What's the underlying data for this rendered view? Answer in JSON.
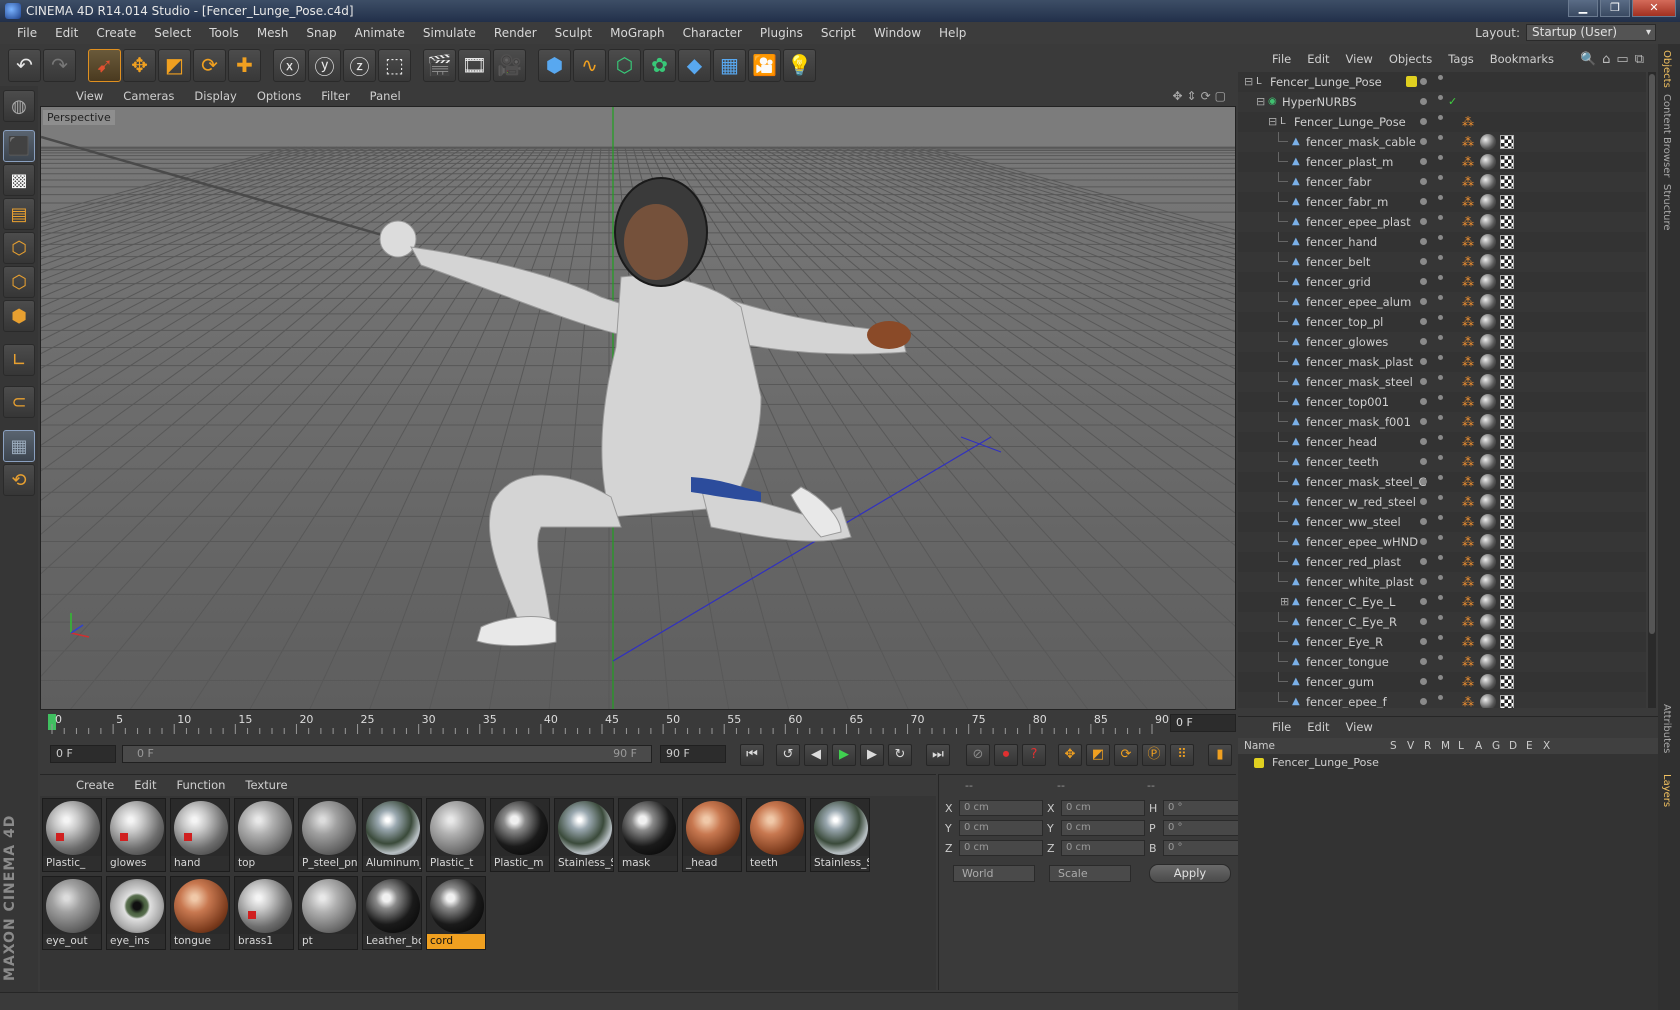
{
  "title_bar": {
    "text": "CINEMA 4D R14.014 Studio - [Fencer_Lunge_Pose.c4d]"
  },
  "menu": [
    "File",
    "Edit",
    "Create",
    "Select",
    "Tools",
    "Mesh",
    "Snap",
    "Animate",
    "Simulate",
    "Render",
    "Sculpt",
    "MoGraph",
    "Character",
    "Plugins",
    "Script",
    "Window",
    "Help"
  ],
  "layout": {
    "label": "Layout:",
    "value": "Startup (User)"
  },
  "viewport": {
    "menu": [
      "View",
      "Cameras",
      "Display",
      "Options",
      "Filter",
      "Panel"
    ],
    "label": "Perspective"
  },
  "timeline": {
    "ticks": [
      "0",
      "5",
      "10",
      "15",
      "20",
      "25",
      "30",
      "35",
      "40",
      "45",
      "50",
      "55",
      "60",
      "65",
      "70",
      "75",
      "80",
      "85",
      "90"
    ],
    "current_frame": "0 F",
    "start_field": "0 F",
    "range_start": "0 F",
    "range_end": "90 F",
    "end_field": "90 F"
  },
  "material_manager": {
    "menu": [
      "Create",
      "Edit",
      "Function",
      "Texture"
    ],
    "materials": [
      {
        "name": "Plastic_",
        "style": "red"
      },
      {
        "name": "glowes",
        "style": "red"
      },
      {
        "name": "hand",
        "style": "red"
      },
      {
        "name": "top",
        "style": "grey"
      },
      {
        "name": "P_steel_pnl",
        "style": "grid"
      },
      {
        "name": "Aluminum_",
        "style": "chrome"
      },
      {
        "name": "Plastic_t",
        "style": "grey"
      },
      {
        "name": "Plastic_m",
        "style": "black"
      },
      {
        "name": "Stainless_S",
        "style": "chrome"
      },
      {
        "name": "mask",
        "style": "black"
      },
      {
        "name": "_head",
        "style": "skin"
      },
      {
        "name": "teeth",
        "style": "skin"
      },
      {
        "name": "Stainless_S",
        "style": "chrome"
      },
      {
        "name": "eye_out",
        "style": "grid"
      },
      {
        "name": "eye_ins",
        "style": "eye"
      },
      {
        "name": "tongue",
        "style": "skin"
      },
      {
        "name": "brass1",
        "style": "red"
      },
      {
        "name": "pt",
        "style": "grey"
      },
      {
        "name": "Leather_bo",
        "style": "black"
      },
      {
        "name": "cord",
        "style": "black",
        "selected": true
      }
    ]
  },
  "coordinates": {
    "headers": [
      "--",
      "--",
      "--"
    ],
    "rows": [
      {
        "a": "X",
        "av": "0 cm",
        "b": "X",
        "bv": "0 cm",
        "c": "H",
        "cv": "0 °"
      },
      {
        "a": "Y",
        "av": "0 cm",
        "b": "Y",
        "bv": "0 cm",
        "c": "P",
        "cv": "0 °"
      },
      {
        "a": "Z",
        "av": "0 cm",
        "b": "Z",
        "bv": "0 cm",
        "c": "B",
        "cv": "0 °"
      }
    ],
    "world": "World",
    "scale": "Scale",
    "apply": "Apply"
  },
  "object_manager": {
    "menu": [
      "File",
      "Edit",
      "View",
      "Objects",
      "Tags",
      "Bookmarks"
    ],
    "objects": [
      {
        "name": "Fencer_Lunge_Pose",
        "level": 0,
        "type": "null",
        "expand": "−"
      },
      {
        "name": "HyperNURBS",
        "level": 1,
        "type": "nurbs",
        "expand": "−"
      },
      {
        "name": "Fencer_Lunge_Pose",
        "level": 2,
        "type": "null",
        "expand": "−"
      },
      {
        "name": "fencer_mask_cable",
        "level": 3
      },
      {
        "name": "fencer_plast_m",
        "level": 3
      },
      {
        "name": "fencer_fabr",
        "level": 3
      },
      {
        "name": "fencer_fabr_m",
        "level": 3
      },
      {
        "name": "fencer_epee_plast",
        "level": 3
      },
      {
        "name": "fencer_hand",
        "level": 3
      },
      {
        "name": "fencer_belt",
        "level": 3
      },
      {
        "name": "fencer_grid",
        "level": 3
      },
      {
        "name": "fencer_epee_alum",
        "level": 3
      },
      {
        "name": "fencer_top_pl",
        "level": 3
      },
      {
        "name": "fencer_glowes",
        "level": 3
      },
      {
        "name": "fencer_mask_plast",
        "level": 3
      },
      {
        "name": "fencer_mask_steel",
        "level": 3
      },
      {
        "name": "fencer_top001",
        "level": 3
      },
      {
        "name": "fencer_mask_f001",
        "level": 3
      },
      {
        "name": "fencer_head",
        "level": 3
      },
      {
        "name": "fencer_teeth",
        "level": 3
      },
      {
        "name": "fencer_mask_steel_C",
        "level": 3
      },
      {
        "name": "fencer_w_red_steel",
        "level": 3
      },
      {
        "name": "fencer_ww_steel",
        "level": 3
      },
      {
        "name": "fencer_epee_wHND",
        "level": 3
      },
      {
        "name": "fencer_red_plast",
        "level": 3
      },
      {
        "name": "fencer_white_plast",
        "level": 3
      },
      {
        "name": "fencer_C_Eye_L",
        "level": 3,
        "expand": "+"
      },
      {
        "name": "fencer_C_Eye_R",
        "level": 3
      },
      {
        "name": "fencer_Eye_R",
        "level": 3
      },
      {
        "name": "fencer_tongue",
        "level": 3
      },
      {
        "name": "fencer_gum",
        "level": 3
      },
      {
        "name": "fencer_epee_f",
        "level": 3
      }
    ]
  },
  "layer_manager": {
    "menu": [
      "File",
      "Edit",
      "View"
    ],
    "columns": [
      "Name",
      "S",
      "V",
      "R",
      "M",
      "L",
      "A",
      "G",
      "D",
      "E",
      "X"
    ],
    "layer_name": "Fencer_Lunge_Pose"
  },
  "right_tabs": [
    "Objects",
    "Content Browser",
    "Structure",
    "Attributes",
    "Layers"
  ],
  "brand": "MAXON CINEMA 4D",
  "colors": {
    "accent": "#f0a020",
    "title_bar": "#2b3a52"
  }
}
